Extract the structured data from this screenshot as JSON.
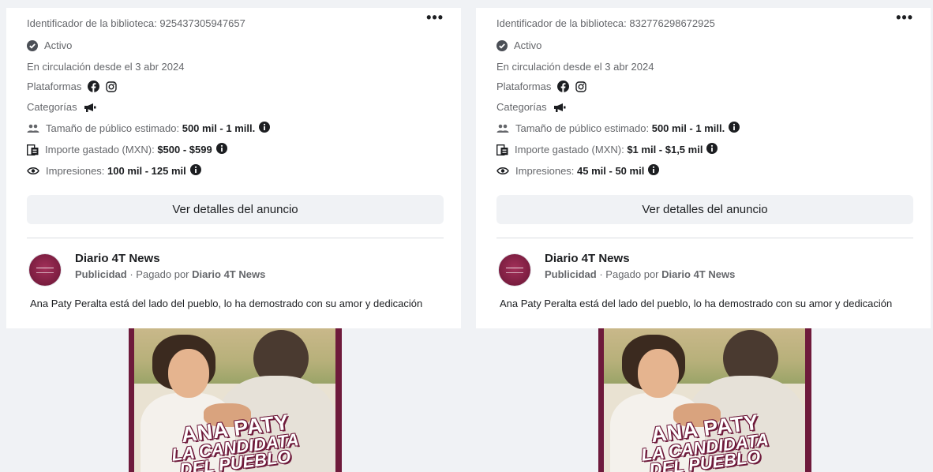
{
  "cards": [
    {
      "library_id": "Identificador de la biblioteca: 925437305947657",
      "more_label": "•••",
      "status": "Activo",
      "running_since": "En circulación desde el 3 abr 2024",
      "platforms_label": "Plataformas",
      "categories_label": "Categorías",
      "audience_label": "Tamaño de público estimado: ",
      "audience_value": "500 mil - 1 mill.",
      "spend_label": "Importe gastado (MXN): ",
      "spend_value": "$500 - $599",
      "impressions_label": "Impresiones: ",
      "impressions_value": "100 mil - 125 mil",
      "details_button": "Ver detalles del anuncio",
      "advertiser_name": "Diario 4T News",
      "ad_label": "Publicidad",
      "paid_by_label": " · Pagado por ",
      "paid_by_name": "Diario 4T News",
      "body_text": "Ana Paty Peralta está del lado del pueblo, lo ha demostrado con su amor y dedicación",
      "poster_title": "ANA PATY",
      "poster_line1": "LA CANDIDATA",
      "poster_line2": "DEL PUEBLO"
    },
    {
      "library_id": "Identificador de la biblioteca: 832776298672925",
      "more_label": "•••",
      "status": "Activo",
      "running_since": "En circulación desde el 3 abr 2024",
      "platforms_label": "Plataformas",
      "categories_label": "Categorías",
      "audience_label": "Tamaño de público estimado: ",
      "audience_value": "500 mil - 1 mill.",
      "spend_label": "Importe gastado (MXN): ",
      "spend_value": "$1 mil - $1,5 mil",
      "impressions_label": "Impresiones: ",
      "impressions_value": "45 mil - 50 mil",
      "details_button": "Ver detalles del anuncio",
      "advertiser_name": "Diario 4T News",
      "ad_label": "Publicidad",
      "paid_by_label": " · Pagado por ",
      "paid_by_name": "Diario 4T News",
      "body_text": "Ana Paty Peralta está del lado del pueblo, lo ha demostrado con su amor y dedicación",
      "poster_title": "ANA PATY",
      "poster_line1": "LA CANDIDATA",
      "poster_line2": "DEL PUEBLO"
    }
  ],
  "icons": {
    "status": "check-circle-icon",
    "platform_1": "facebook-icon",
    "platform_2": "instagram-icon",
    "category": "megaphone-icon",
    "audience": "people-icon",
    "spend": "money-icon",
    "impressions": "eye-icon",
    "info": "info-icon"
  },
  "colors": {
    "page_bg": "#f0f2f5",
    "card_bg": "#ffffff",
    "text_primary": "#1c1e21",
    "text_secondary": "#65676b",
    "poster_brand": "#6e1a3b"
  }
}
